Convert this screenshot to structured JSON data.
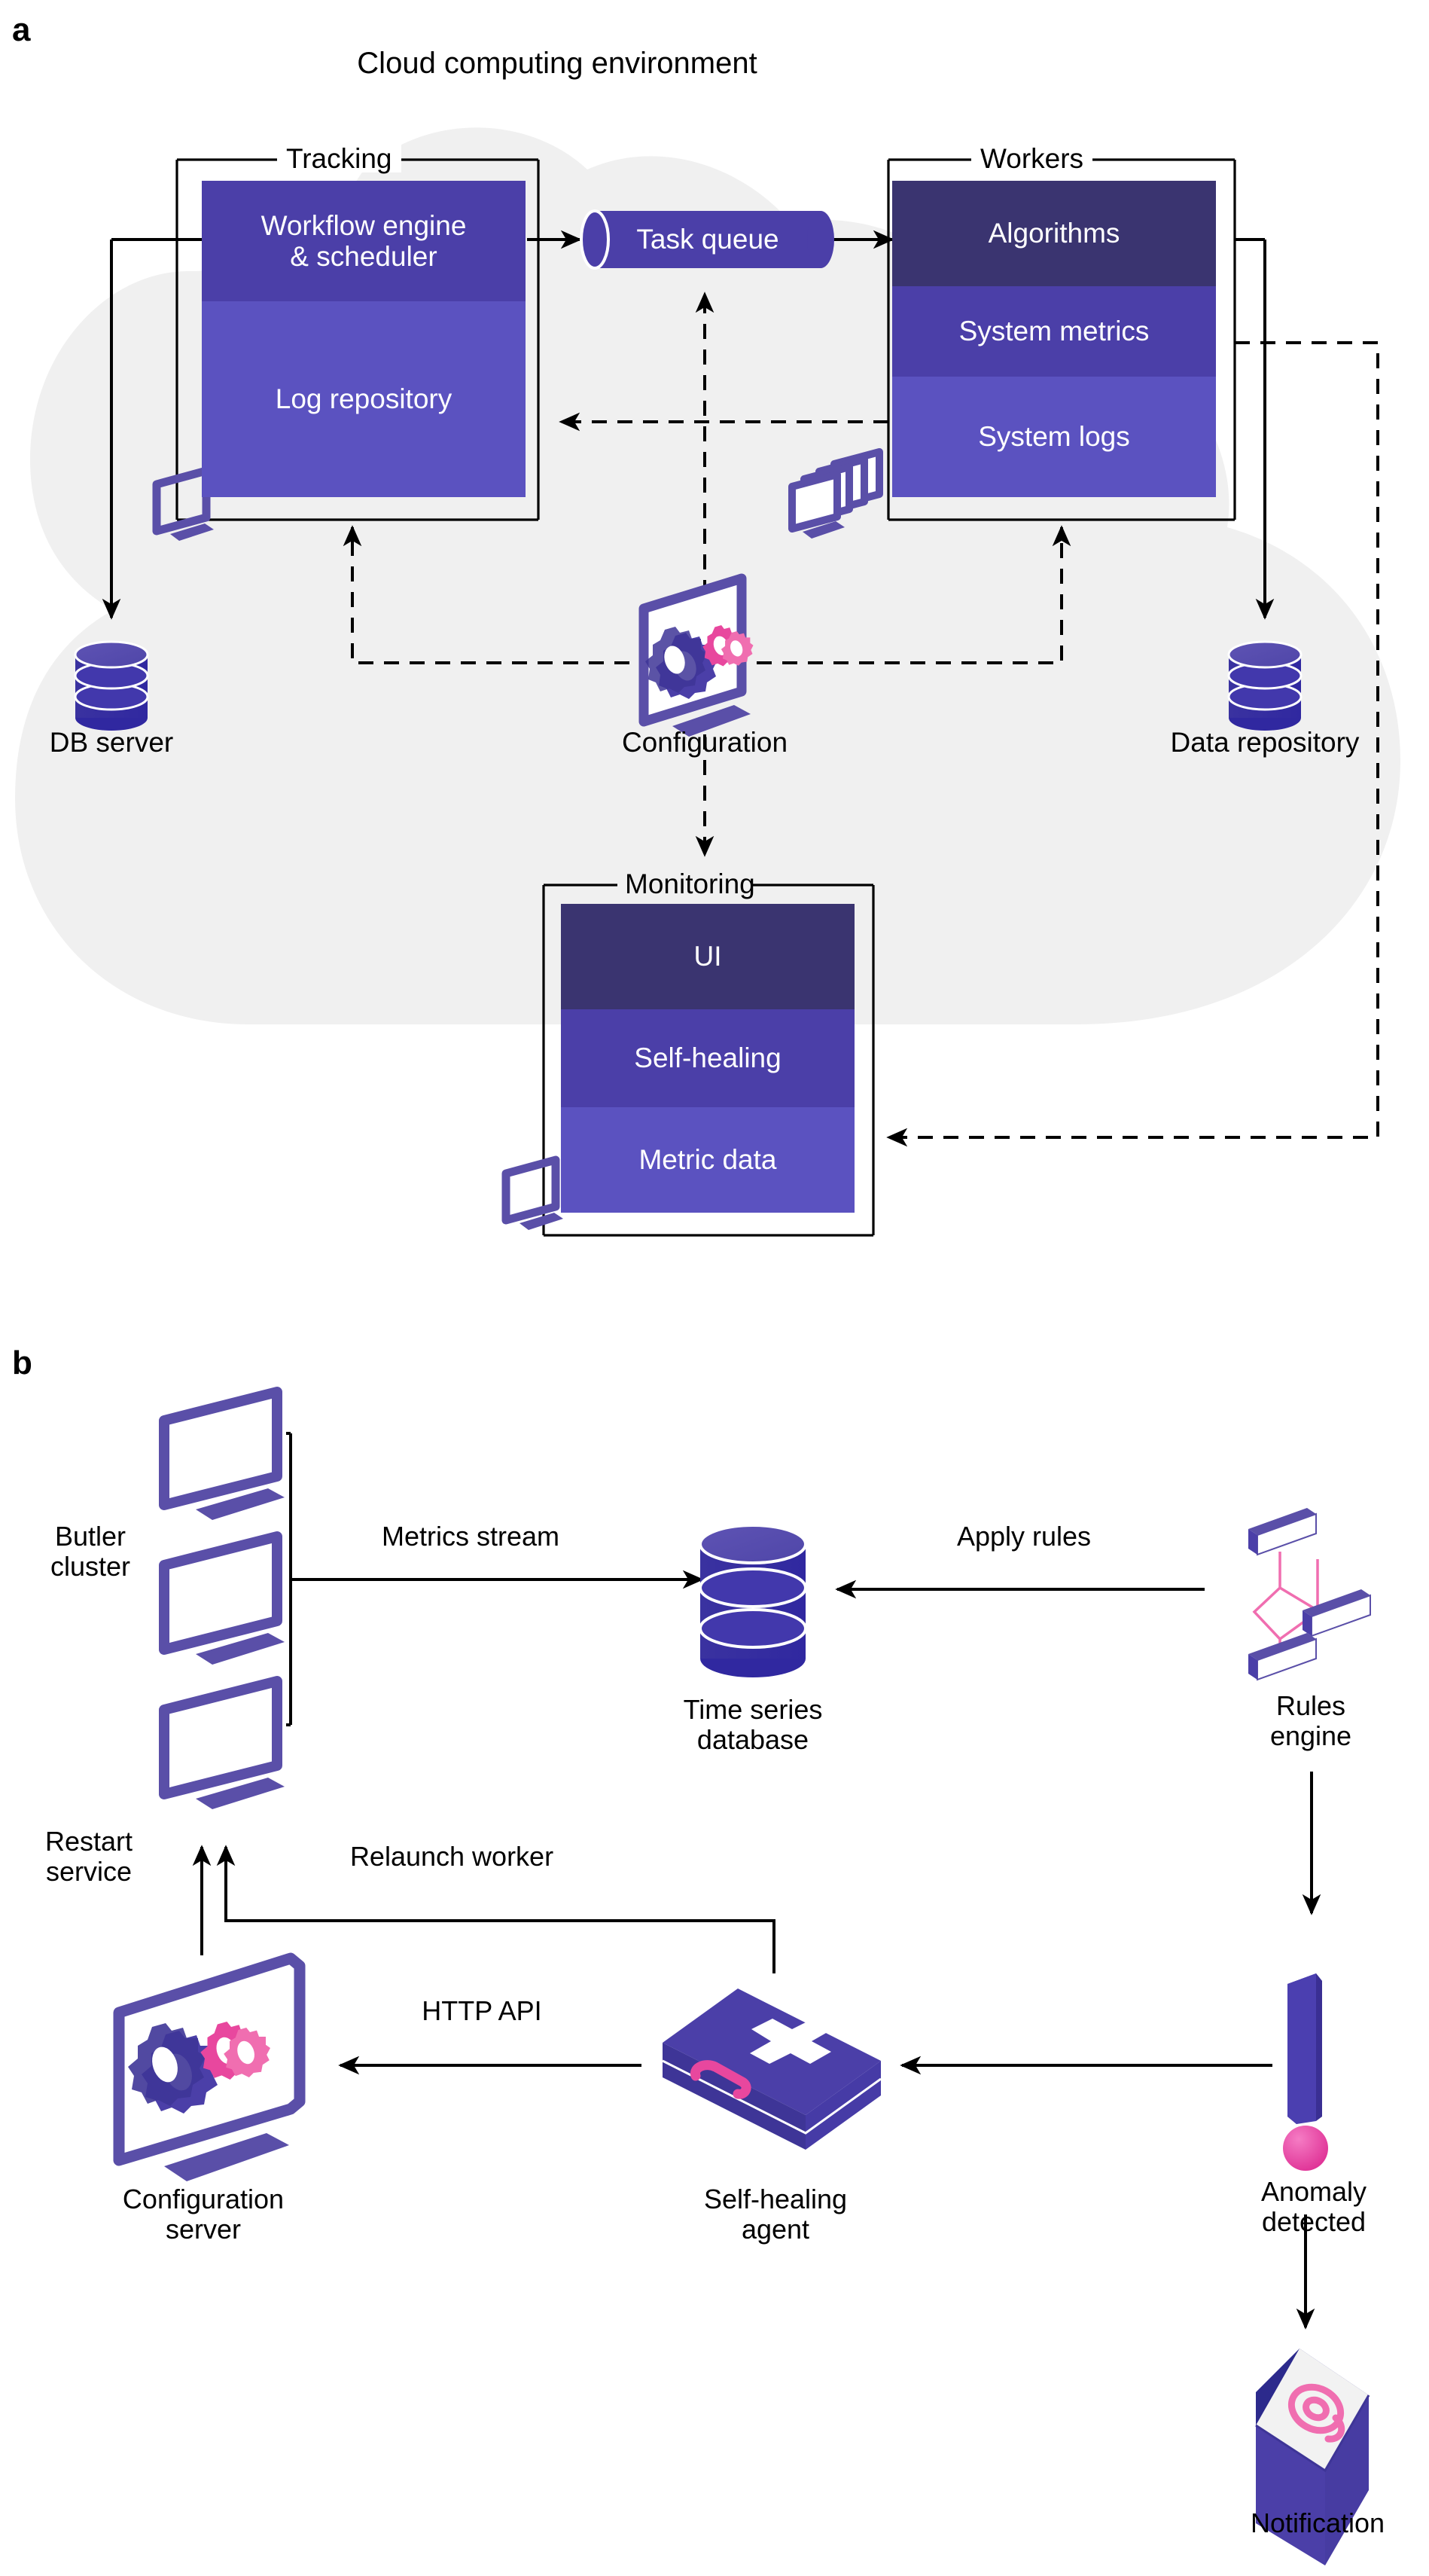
{
  "panels": [
    {
      "id": "a",
      "letter": "a"
    },
    {
      "id": "b",
      "letter": "b"
    }
  ],
  "panel_a": {
    "title": "Cloud computing environment",
    "groups": [
      {
        "name": "tracking",
        "label": "Tracking"
      },
      {
        "name": "workers",
        "label": "Workers"
      },
      {
        "name": "monitoring",
        "label": "Monitoring"
      }
    ],
    "tracking_blocks": [
      {
        "label": "Workflow engine\n& scheduler",
        "color": "#4B3FA8"
      },
      {
        "label": "Log repository",
        "color": "#5B52C0"
      }
    ],
    "workers_blocks": [
      {
        "label": "Algorithms",
        "color": "#3A3470"
      },
      {
        "label": "System metrics",
        "color": "#4B3FA8"
      },
      {
        "label": "System logs",
        "color": "#5B52C0"
      }
    ],
    "monitoring_blocks": [
      {
        "label": "UI",
        "color": "#3A3470"
      },
      {
        "label": "Self-healing",
        "color": "#4B3FA8"
      },
      {
        "label": "Metric data",
        "color": "#5B52C0"
      }
    ],
    "queue_label": "Task queue",
    "nodes": [
      {
        "name": "db-server",
        "label": "DB server"
      },
      {
        "name": "configuration",
        "label": "Configuration"
      },
      {
        "name": "data-repository",
        "label": "Data repository"
      }
    ]
  },
  "panel_b": {
    "nodes": [
      {
        "name": "butler-cluster",
        "label": "Butler\ncluster"
      },
      {
        "name": "time-series-database",
        "label": "Time series\ndatabase"
      },
      {
        "name": "rules-engine",
        "label": "Rules\nengine"
      },
      {
        "name": "anomaly-detected",
        "label": "Anomaly\ndetected"
      },
      {
        "name": "notification",
        "label": "Notification"
      },
      {
        "name": "self-healing-agent",
        "label": "Self-healing\nagent"
      },
      {
        "name": "configuration-server",
        "label": "Configuration\nserver"
      }
    ],
    "edges": [
      {
        "name": "metrics-stream",
        "label": "Metrics stream"
      },
      {
        "name": "apply-rules",
        "label": "Apply rules"
      },
      {
        "name": "relaunch-worker",
        "label": "Relaunch worker"
      },
      {
        "name": "restart-service",
        "label": "Restart\nservice"
      },
      {
        "name": "http-api",
        "label": "HTTP API"
      }
    ]
  },
  "colors": {
    "dark_purple": "#3A3470",
    "mid_purple": "#4B3FA8",
    "light_purple": "#5B52C0",
    "icon_purple": "#5A4FA8",
    "icon_purple_dark": "#3E3597",
    "pink": "#E8479E",
    "pink_light": "#F06EB0",
    "cloud_gray": "#F0F0F0",
    "line_black": "#000000"
  }
}
